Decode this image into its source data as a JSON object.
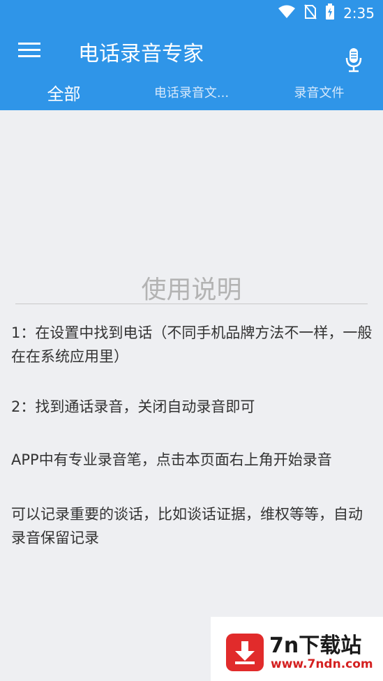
{
  "status_bar": {
    "time": "2:35",
    "icons": [
      "wifi-icon",
      "no-sim-icon",
      "battery-charging-icon"
    ]
  },
  "toolbar": {
    "title": "电话录音专家",
    "menu_icon": "hamburger-menu-icon",
    "mic_icon": "microphone-icon"
  },
  "tabs": [
    {
      "label": "全部",
      "active": true
    },
    {
      "label": "电话录音文...",
      "active": false
    },
    {
      "label": "录音文件",
      "active": false
    }
  ],
  "content": {
    "section_title": "使用说明",
    "instructions": [
      "1：在设置中找到电话（不同手机品牌方法不一样，一般在在系统应用里）",
      "2：找到通话录音，关闭自动录音即可",
      "APP中有专业录音笔，点击本页面右上角开始录音",
      "可以记录重要的谈话，比如谈话证据，维权等等，自动录音保留记录"
    ]
  },
  "watermark": {
    "name": "7n下载站",
    "url": "www.7ndn.com"
  },
  "colors": {
    "primary": "#2f95e8",
    "background": "#eeeff2",
    "watermark_red": "#e12b2b"
  }
}
